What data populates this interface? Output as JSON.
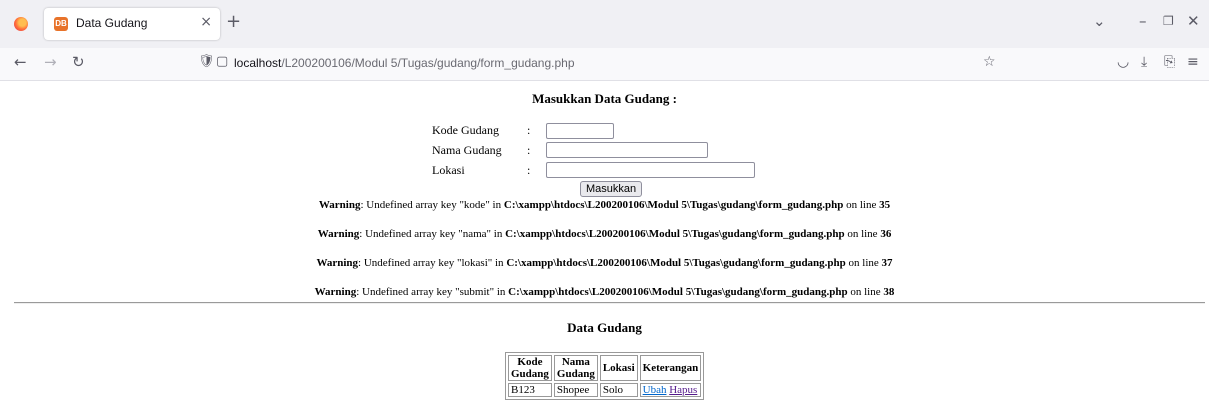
{
  "browser": {
    "tab_title": "Data Gudang",
    "tab_favicon": "DB",
    "close_glyph": "×",
    "new_tab_glyph": "+",
    "url_host": "localhost",
    "url_path": "/L200200106/Modul 5/Tugas/gudang/form_gudang.php"
  },
  "form": {
    "title": "Masukkan Data Gudang :",
    "colon": ":",
    "fields": [
      {
        "label": "Kode Gudang"
      },
      {
        "label": "Nama Gudang"
      },
      {
        "label": "Lokasi"
      }
    ],
    "submit_label": "Masukkan"
  },
  "warnings": [
    {
      "label": "Warning",
      "msg": ": Undefined array key \"kode\" in ",
      "file": "C:\\xampp\\htdocs\\L200200106\\Modul 5\\Tugas\\gudang\\form_gudang.php",
      "on_line": " on line ",
      "line": "35"
    },
    {
      "label": "Warning",
      "msg": ": Undefined array key \"nama\" in ",
      "file": "C:\\xampp\\htdocs\\L200200106\\Modul 5\\Tugas\\gudang\\form_gudang.php",
      "on_line": " on line ",
      "line": "36"
    },
    {
      "label": "Warning",
      "msg": ": Undefined array key \"lokasi\" in ",
      "file": "C:\\xampp\\htdocs\\L200200106\\Modul 5\\Tugas\\gudang\\form_gudang.php",
      "on_line": " on line ",
      "line": "37"
    },
    {
      "label": "Warning",
      "msg": ": Undefined array key \"submit\" in ",
      "file": "C:\\xampp\\htdocs\\L200200106\\Modul 5\\Tugas\\gudang\\form_gudang.php",
      "on_line": " on line ",
      "line": "38"
    }
  ],
  "table": {
    "title": "Data Gudang",
    "headers": [
      {
        "line1": "Kode",
        "line2": "Gudang"
      },
      {
        "line1": "Nama",
        "line2": "Gudang"
      },
      {
        "line1": "Lokasi",
        "line2": ""
      },
      {
        "line1": "Keterangan",
        "line2": ""
      }
    ],
    "rows": [
      {
        "kode": "B123",
        "nama": "Shopee",
        "lokasi": "Solo",
        "edit": "Ubah",
        "delete": "Hapus"
      }
    ]
  }
}
